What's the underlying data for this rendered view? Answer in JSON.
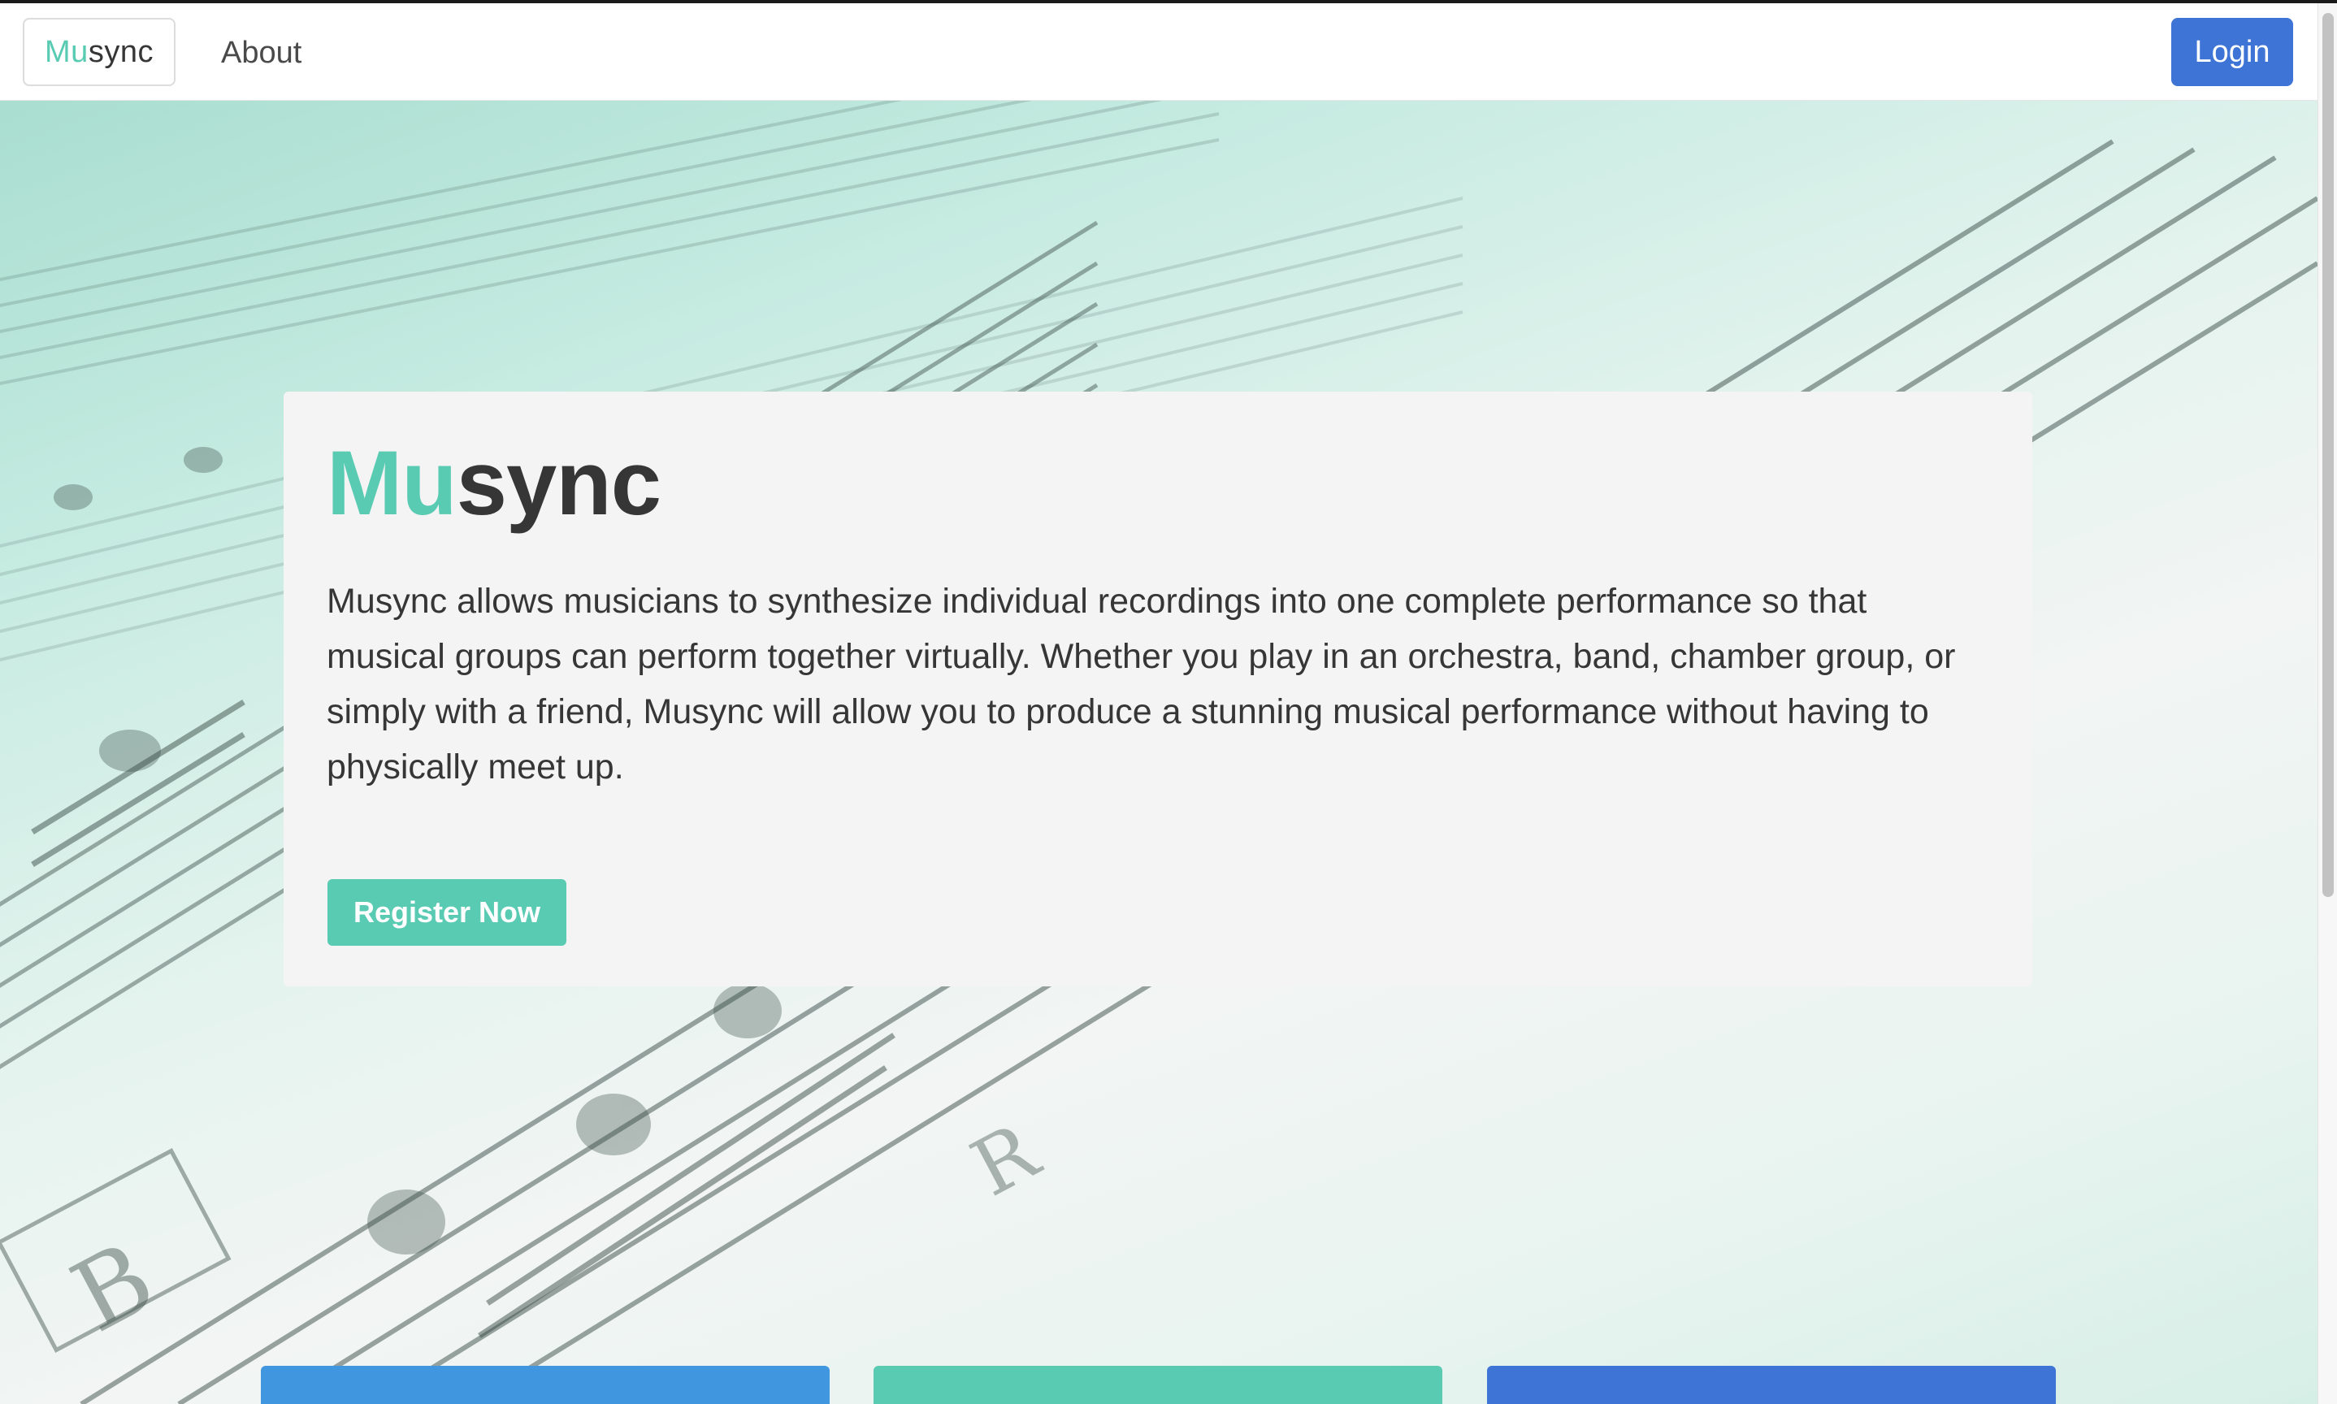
{
  "navbar": {
    "brand_accent": "Mu",
    "brand_rest": "sync",
    "about_label": "About",
    "login_label": "Login"
  },
  "hero": {
    "title_accent": "Mu",
    "title_rest": "sync",
    "description": "Musync allows musicians to synthesize individual recordings into one complete performance so that musical groups can perform together virtually. Whether you play in an orchestra, band, chamber group, or simply with a friend, Musync will allow you to produce a stunning musical performance without having to physically meet up.",
    "register_label": "Register Now",
    "background_image": "sheet-music-photo"
  },
  "feature_cards": [
    {
      "color": "#4196e0"
    },
    {
      "color": "#5acbb3"
    },
    {
      "color": "#3e74d6"
    }
  ],
  "colors": {
    "accent": "#5acbb3",
    "primary": "#3e74d6",
    "text": "#363636"
  },
  "scrollbar": {
    "position": 0
  }
}
